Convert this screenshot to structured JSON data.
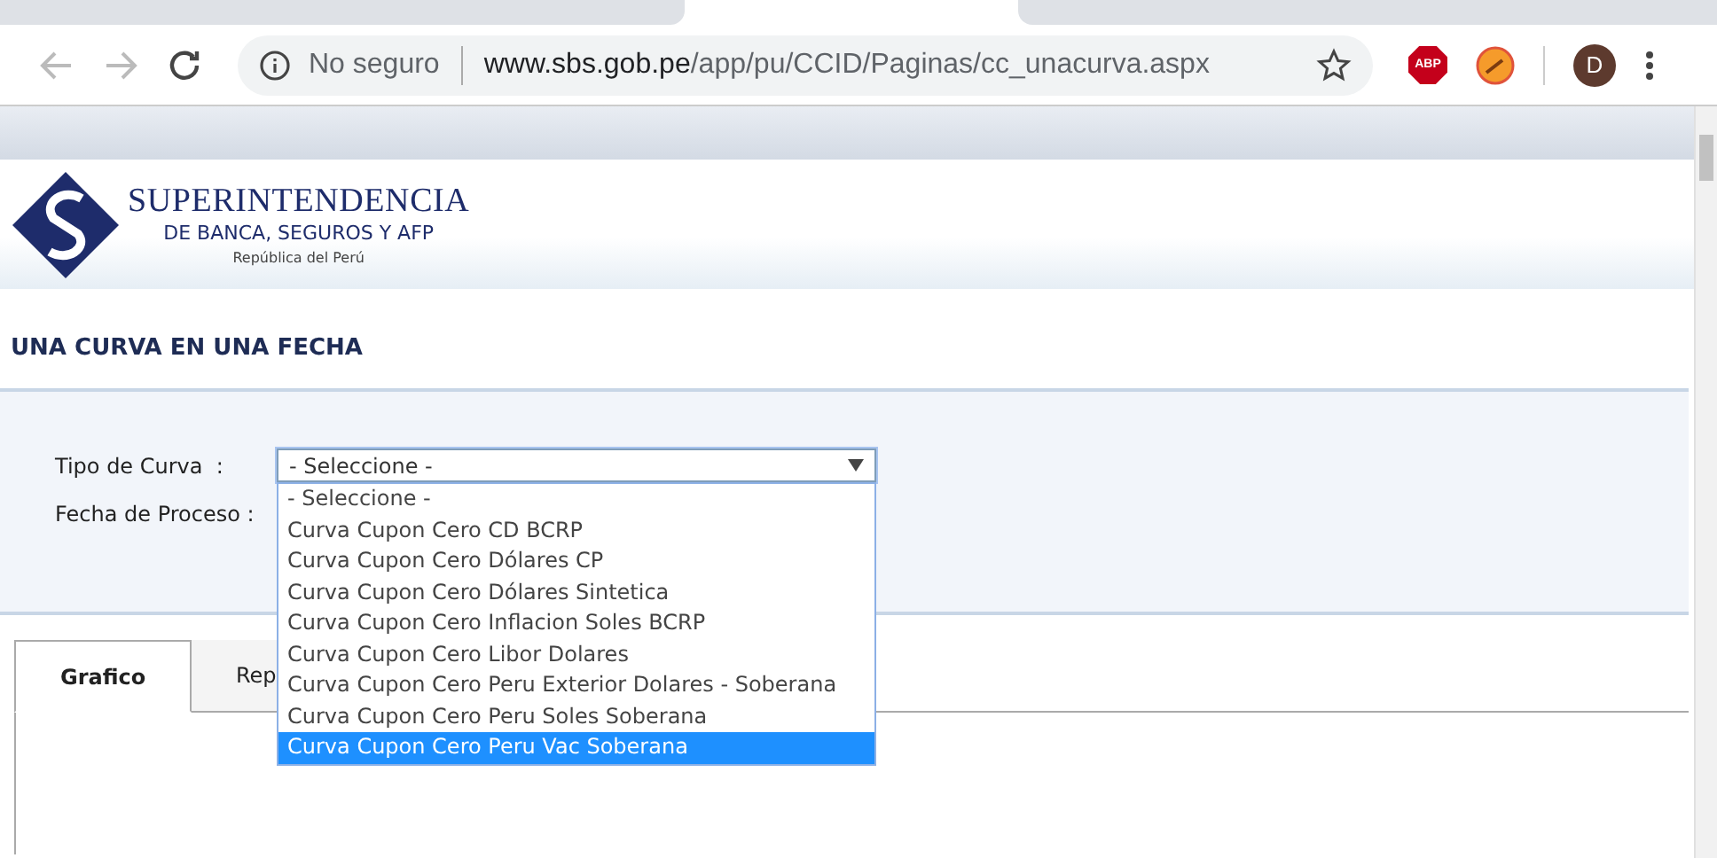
{
  "browser": {
    "security": "No seguro",
    "url_host": "www.sbs.gob.pe",
    "url_path": "/app/pu/CCID/Paginas/cc_unacurva.aspx",
    "extension_label": "ABP",
    "avatar": "D"
  },
  "header": {
    "logo_title": "SUPERINTENDENCIA",
    "logo_subtitle": "DE BANCA, SEGUROS Y AFP",
    "logo_country": "República del Perú"
  },
  "page_title": "UNA CURVA EN UNA FECHA",
  "form": {
    "fields": [
      {
        "label": "Tipo de Curva  :",
        "kind": "select",
        "value": "- Seleccione -"
      },
      {
        "label": "Fecha de Proceso :"
      }
    ],
    "dropdown": {
      "expanded": true,
      "options": [
        {
          "label": "- Seleccione -",
          "selected": false
        },
        {
          "label": "Curva Cupon Cero CD BCRP",
          "selected": false
        },
        {
          "label": "Curva Cupon Cero Dólares CP",
          "selected": false
        },
        {
          "label": "Curva Cupon Cero Dólares Sintetica",
          "selected": false
        },
        {
          "label": "Curva Cupon Cero Inflacion Soles BCRP",
          "selected": false
        },
        {
          "label": "Curva Cupon Cero Libor Dolares",
          "selected": false
        },
        {
          "label": "Curva Cupon Cero Peru Exterior Dolares - Soberana",
          "selected": false
        },
        {
          "label": "Curva Cupon Cero Peru Soles Soberana",
          "selected": false
        },
        {
          "label": "Curva Cupon Cero Peru Vac Soberana",
          "selected": true
        }
      ]
    }
  },
  "tabs": [
    {
      "label": "Grafico",
      "selected": true
    },
    {
      "label": "Rep",
      "selected": false
    }
  ]
}
